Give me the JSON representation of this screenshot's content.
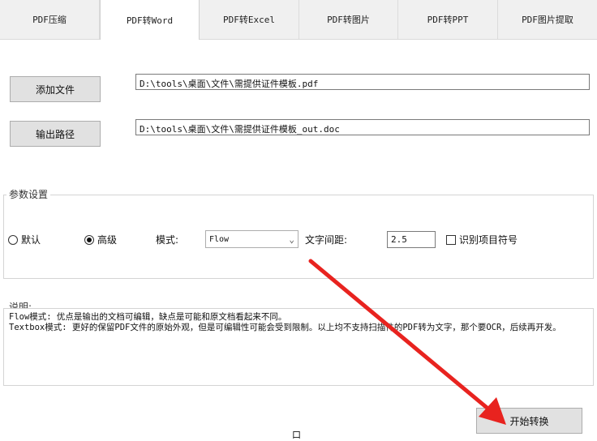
{
  "tabs": [
    {
      "label": "PDF压缩"
    },
    {
      "label": "PDF转Word"
    },
    {
      "label": "PDF转Excel"
    },
    {
      "label": "PDF转图片"
    },
    {
      "label": "PDF转PPT"
    },
    {
      "label": "PDF图片提取"
    }
  ],
  "active_tab": "PDF转Word",
  "files": {
    "add_button": "添加文件",
    "input_path": "D:\\tools\\桌面\\文件\\需提供证件模板.pdf",
    "output_button": "输出路径",
    "output_path": "D:\\tools\\桌面\\文件\\需提供证件模板_out.doc"
  },
  "params": {
    "legend": "参数设置",
    "radio_default": "默认",
    "radio_advanced": "高级",
    "selected_radio": "高级",
    "mode_label": "模式:",
    "mode_value": "Flow",
    "spacing_label": "文字间距:",
    "spacing_value": "2.5",
    "recognize_label": "识别项目符号",
    "recognize_checked": false
  },
  "description": {
    "legend": "说明:",
    "lines": [
      "Flow模式: 优点是输出的文档可编辑，缺点是可能和原文档看起来不同。",
      "Textbox模式: 更好的保留PDF文件的原始外观，但是可编辑性可能会受到限制。以上均不支持扫描件的PDF转为文字，那个要OCR，后续再开发。"
    ]
  },
  "start_button": "开始转换",
  "stray_char": "口",
  "colors": {
    "arrow": "#e8231f"
  }
}
